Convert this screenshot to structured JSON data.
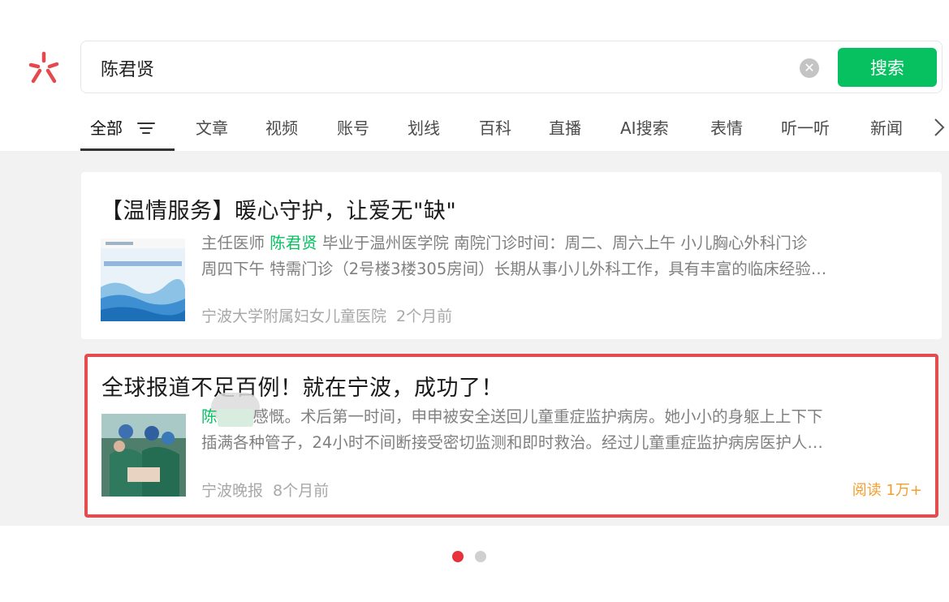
{
  "search": {
    "query": "陈君贤",
    "button_label": "搜索",
    "clear_icon": "clear-circle-icon"
  },
  "tabs": [
    {
      "label": "全部",
      "active": true
    },
    {
      "label": "文章"
    },
    {
      "label": "视频"
    },
    {
      "label": "账号"
    },
    {
      "label": "划线"
    },
    {
      "label": "百科"
    },
    {
      "label": "直播"
    },
    {
      "label": "AI搜索"
    },
    {
      "label": "表情"
    },
    {
      "label": "听一听"
    },
    {
      "label": "新闻"
    }
  ],
  "results": [
    {
      "title": "【温情服务】暖心守护，让爱无\"缺\"",
      "snippet_line1_pre": "主任医师 ",
      "snippet_line1_hl": "陈君贤",
      "snippet_line1_post": " 毕业于温州医学院 南院门诊时间：周二、周六上午 小儿胸心外科门诊",
      "snippet_line2": "周四下午 特需门诊（2号楼3楼305房间）长期从事小儿外科工作，具有丰富的临床经验…",
      "source": "宁波大学附属妇女儿童医院",
      "time": "2个月前"
    },
    {
      "title": "全球报道不足百例！就在宁波，成功了！",
      "snippet_line1_hl": "陈",
      "snippet_line1_post": "感慨。术后第一时间，申申被安全送回儿童重症监护病房。她小小的身躯上上下下",
      "snippet_line2": "插满各种管子，24小时不间断接受密切监测和即时救治。经过儿童重症监护病房医护人…",
      "source": "宁波晚报",
      "time": "8个月前",
      "read_count": "阅读 1万+"
    }
  ],
  "pager": {
    "total": 2,
    "current": 1
  },
  "colors": {
    "accent": "#07c160",
    "highlight_border": "#e34d4d",
    "read_count": "#f29e2e",
    "pager_active": "#e8313a"
  }
}
